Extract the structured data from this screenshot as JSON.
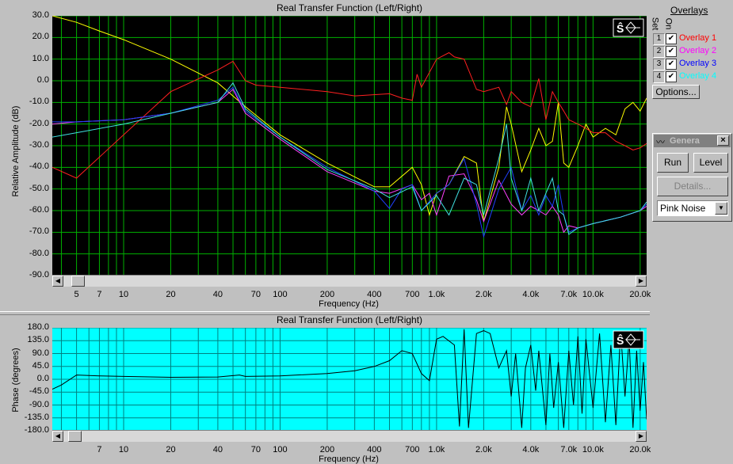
{
  "colors": {
    "bg_top": "#000000",
    "grid_top": "#00b000",
    "bg_bottom": "#00ffff",
    "grid_bottom": "#008080",
    "yellow": "#ffff00",
    "red": "#ff2020",
    "magenta": "#ff40ff",
    "blue": "#2040ff",
    "cyan": "#40e0e0"
  },
  "top_chart": {
    "title": "Real Transfer Function (Left/Right)",
    "ylabel": "Relative Amplitude (dB)",
    "xlabel": "Frequency (Hz)",
    "yticks": [
      "30.0",
      "20.0",
      "10.0",
      "0.0",
      "-10.0",
      "-20.0",
      "-30.0",
      "-40.0",
      "-50.0",
      "-60.0",
      "-70.0",
      "-80.0",
      "-90.0"
    ],
    "xticks": [
      "5",
      "7",
      "10",
      "20",
      "40",
      "70",
      "100",
      "200",
      "400",
      "700",
      "1.0k",
      "2.0k",
      "4.0k",
      "7.0k",
      "10.0k",
      "20.0k"
    ]
  },
  "bottom_chart": {
    "title": "Real Transfer Function (Left/Right)",
    "ylabel": "Phase (degrees)",
    "xlabel": "Frequency (Hz)",
    "yticks": [
      "180.0",
      "135.0",
      "90.0",
      "45.0",
      "0.0",
      "-45.0",
      "-90.0",
      "-135.0",
      "-180.0"
    ],
    "xticks": [
      "7",
      "10",
      "20",
      "40",
      "70",
      "100",
      "200",
      "400",
      "700",
      "1.0k",
      "2.0k",
      "4.0k",
      "7.0k",
      "10.0k",
      "20.0k"
    ]
  },
  "chart_data": [
    {
      "type": "line",
      "title": "Real Transfer Function (Left/Right)",
      "xlabel": "Frequency (Hz)",
      "ylabel": "Relative Amplitude (dB)",
      "xscale": "log",
      "xlim": [
        3.5,
        22000
      ],
      "ylim": [
        -90,
        30
      ],
      "grid": true,
      "series": [
        {
          "name": "",
          "color": "yellow",
          "x": [
            3.5,
            5,
            7,
            10,
            20,
            40,
            60,
            100,
            200,
            400,
            500,
            700,
            800,
            900,
            1000,
            1200,
            1500,
            1800,
            2000,
            2500,
            2800,
            3000,
            3500,
            4000,
            4500,
            5000,
            5500,
            6000,
            6500,
            7000,
            8000,
            9000,
            10000,
            12000,
            14000,
            16000,
            18000,
            20000,
            22000
          ],
          "y": [
            30,
            27,
            23,
            19,
            10,
            -1,
            -12,
            -25,
            -38,
            -49,
            -49,
            -40,
            -48,
            -62,
            -52,
            -48,
            -35,
            -38,
            -65,
            -40,
            -12,
            -20,
            -42,
            -32,
            -22,
            -30,
            -28,
            -10,
            -38,
            -40,
            -30,
            -20,
            -26,
            -22,
            -25,
            -13,
            -10,
            -14,
            -8
          ]
        },
        {
          "name": "Overlay 1",
          "color": "red",
          "x": [
            3.5,
            5,
            10,
            20,
            40,
            50,
            60,
            70,
            100,
            200,
            300,
            500,
            600,
            700,
            750,
            800,
            1000,
            1200,
            1300,
            1500,
            1800,
            2000,
            2500,
            2800,
            3000,
            3500,
            4000,
            4500,
            5000,
            5500,
            6000,
            6500,
            7000,
            8000,
            9000,
            10000,
            12000,
            14000,
            16000,
            18000,
            20000,
            22000
          ],
          "y": [
            -40,
            -45,
            -25,
            -5,
            5,
            9,
            0,
            -2,
            -3,
            -5,
            -7,
            -6,
            -8,
            -9,
            3,
            -3,
            10,
            13,
            11,
            10,
            -4,
            -5,
            -3,
            -11,
            -5,
            -10,
            -12,
            1,
            -18,
            -5,
            -10,
            -14,
            -18,
            -20,
            -22,
            -24,
            -24,
            -28,
            -30,
            -32,
            -31,
            -29
          ]
        },
        {
          "name": "Overlay 2",
          "color": "magenta",
          "x": [
            3.5,
            5,
            10,
            20,
            40,
            50,
            60,
            100,
            200,
            400,
            500,
            700,
            800,
            900,
            1000,
            1200,
            1500,
            1800,
            2000,
            2500,
            3000,
            3500,
            4000,
            4500,
            5000,
            5500,
            6000,
            6500,
            7000,
            8000,
            10000,
            15000,
            20000,
            22000
          ],
          "y": [
            -20,
            -19,
            -18,
            -15,
            -10,
            -4,
            -15,
            -27,
            -42,
            -51,
            -52,
            -48,
            -55,
            -52,
            -62,
            -44,
            -43,
            -55,
            -65,
            -46,
            -57,
            -62,
            -58,
            -60,
            -62,
            -58,
            -62,
            -70,
            -67,
            -68,
            -66,
            -63,
            -60,
            -58
          ]
        },
        {
          "name": "Overlay 3",
          "color": "blue",
          "x": [
            3.5,
            5,
            10,
            20,
            40,
            50,
            60,
            100,
            200,
            400,
            500,
            600,
            700,
            800,
            1000,
            1200,
            1500,
            1800,
            2000,
            2500,
            3000,
            3500,
            4000,
            4500,
            5000,
            5500,
            6000,
            6500,
            7000,
            8000,
            10000,
            15000,
            20000,
            22000
          ],
          "y": [
            -19,
            -19,
            -18,
            -15,
            -9,
            -3,
            -14,
            -26,
            -40,
            -51,
            -59,
            -50,
            -48,
            -60,
            -52,
            -48,
            -36,
            -57,
            -72,
            -50,
            -40,
            -60,
            -53,
            -62,
            -53,
            -58,
            -48,
            -62,
            -70,
            -68,
            -66,
            -63,
            -60,
            -57
          ]
        },
        {
          "name": "Overlay 4",
          "color": "cyan",
          "x": [
            3.5,
            5,
            10,
            20,
            40,
            50,
            60,
            100,
            200,
            400,
            500,
            700,
            800,
            1000,
            1200,
            1500,
            1800,
            2000,
            2500,
            2800,
            3000,
            3500,
            4000,
            4500,
            5000,
            5500,
            6000,
            6500,
            7000,
            8000,
            10000,
            15000,
            20000,
            22000
          ],
          "y": [
            -26,
            -24,
            -20,
            -15,
            -10,
            -1,
            -13,
            -26,
            -41,
            -50,
            -54,
            -49,
            -60,
            -53,
            -62,
            -45,
            -48,
            -62,
            -36,
            -20,
            -45,
            -60,
            -45,
            -60,
            -52,
            -45,
            -60,
            -62,
            -71,
            -68,
            -66,
            -63,
            -60,
            -56
          ]
        }
      ]
    },
    {
      "type": "line",
      "title": "Real Transfer Function (Left/Right)",
      "xlabel": "Frequency (Hz)",
      "ylabel": "Phase (degrees)",
      "xscale": "log",
      "xlim": [
        3.5,
        22000
      ],
      "ylim": [
        -180,
        180
      ],
      "grid": true,
      "series": [
        {
          "name": "",
          "color": "black",
          "x": [
            3.5,
            4,
            5,
            7,
            10,
            20,
            40,
            55,
            60,
            100,
            200,
            300,
            400,
            500,
            600,
            700,
            800,
            900,
            1000,
            1100,
            1300,
            1400,
            1500,
            1600,
            1800,
            2000,
            2200,
            2500,
            2800,
            3000,
            3200,
            3500,
            3700,
            4000,
            4300,
            4500,
            5000,
            5300,
            5600,
            6000,
            6500,
            7000,
            7500,
            8000,
            8500,
            9000,
            10000,
            11000,
            12000,
            13000,
            14000,
            15000,
            16000,
            17000,
            18000,
            19000,
            20000,
            21000,
            22000
          ],
          "y": [
            -35,
            -20,
            15,
            12,
            10,
            7,
            8,
            15,
            10,
            12,
            20,
            30,
            45,
            65,
            100,
            90,
            20,
            -5,
            140,
            150,
            120,
            -165,
            175,
            -170,
            160,
            170,
            160,
            40,
            100,
            -60,
            90,
            -170,
            40,
            120,
            -40,
            100,
            -160,
            90,
            -100,
            60,
            -170,
            100,
            -90,
            150,
            -120,
            140,
            -100,
            160,
            -150,
            120,
            -160,
            170,
            -60,
            140,
            -170,
            100,
            -110,
            60,
            -140
          ]
        }
      ]
    }
  ],
  "overlays_panel": {
    "title": "Overlays",
    "col_set": "Set",
    "col_on": "On",
    "items": [
      {
        "num": "1",
        "label": "Overlay 1",
        "color": "#ff0000"
      },
      {
        "num": "2",
        "label": "Overlay 2",
        "color": "#ff00ff"
      },
      {
        "num": "3",
        "label": "Overlay 3",
        "color": "#0000ff"
      },
      {
        "num": "4",
        "label": "Overlay 4",
        "color": "#00ffff"
      }
    ],
    "options_button": "Options..."
  },
  "generator": {
    "title": "Genera",
    "close": "×",
    "run": "Run",
    "level": "Level",
    "details": "Details...",
    "signal": "Pink Noise"
  },
  "chart_logo": "Ŝ"
}
